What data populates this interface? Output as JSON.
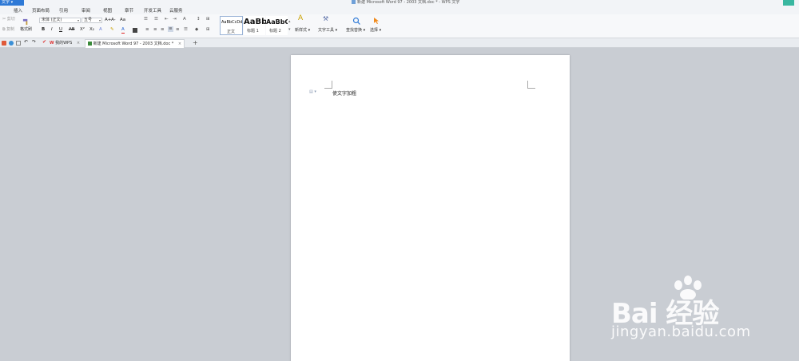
{
  "window": {
    "app_menu": "文字",
    "title": "新建 Microsoft Word 97 - 2003 文档.doc * - WPS 文字"
  },
  "menu_tabs": [
    "插入",
    "页面布局",
    "引用",
    "审阅",
    "视图",
    "章节",
    "开发工具",
    "云服务"
  ],
  "ribbon": {
    "cut": "剪切",
    "copy": "复制",
    "format_painter": "格式刷",
    "font_name": "宋体 (正文)",
    "font_size": "五号",
    "grow_font": "A+",
    "shrink_font": "A-",
    "clear_format": "Aa",
    "bold": "B",
    "italic": "I",
    "underline": "U",
    "strike": "AB",
    "superscript": "X²",
    "subscript": "X₂",
    "font_color": "A",
    "styles": [
      {
        "sample": "AaBbCcDd",
        "name": "正文"
      },
      {
        "sample": "AaBb",
        "name": "标题 1"
      },
      {
        "sample": "AaBbC",
        "name": "标题 2"
      }
    ],
    "new_style": "新样式",
    "text_tools": "文字工具",
    "find_replace": "查找替换",
    "select": "选择"
  },
  "doc_tabs": [
    {
      "label": "我的WPS",
      "close": "×"
    },
    {
      "label": "新建 Microsoft Word 97 - 2003 文档.doc *",
      "close": "×"
    }
  ],
  "new_tab": "+",
  "document": {
    "text": "使文字加粗"
  },
  "watermark": {
    "brand": "Bai 经验",
    "url": "jingyan.baidu.com"
  },
  "colors": {
    "accent": "#2e79d6",
    "workspace": "#c9cdd3",
    "page": "#ffffff"
  }
}
